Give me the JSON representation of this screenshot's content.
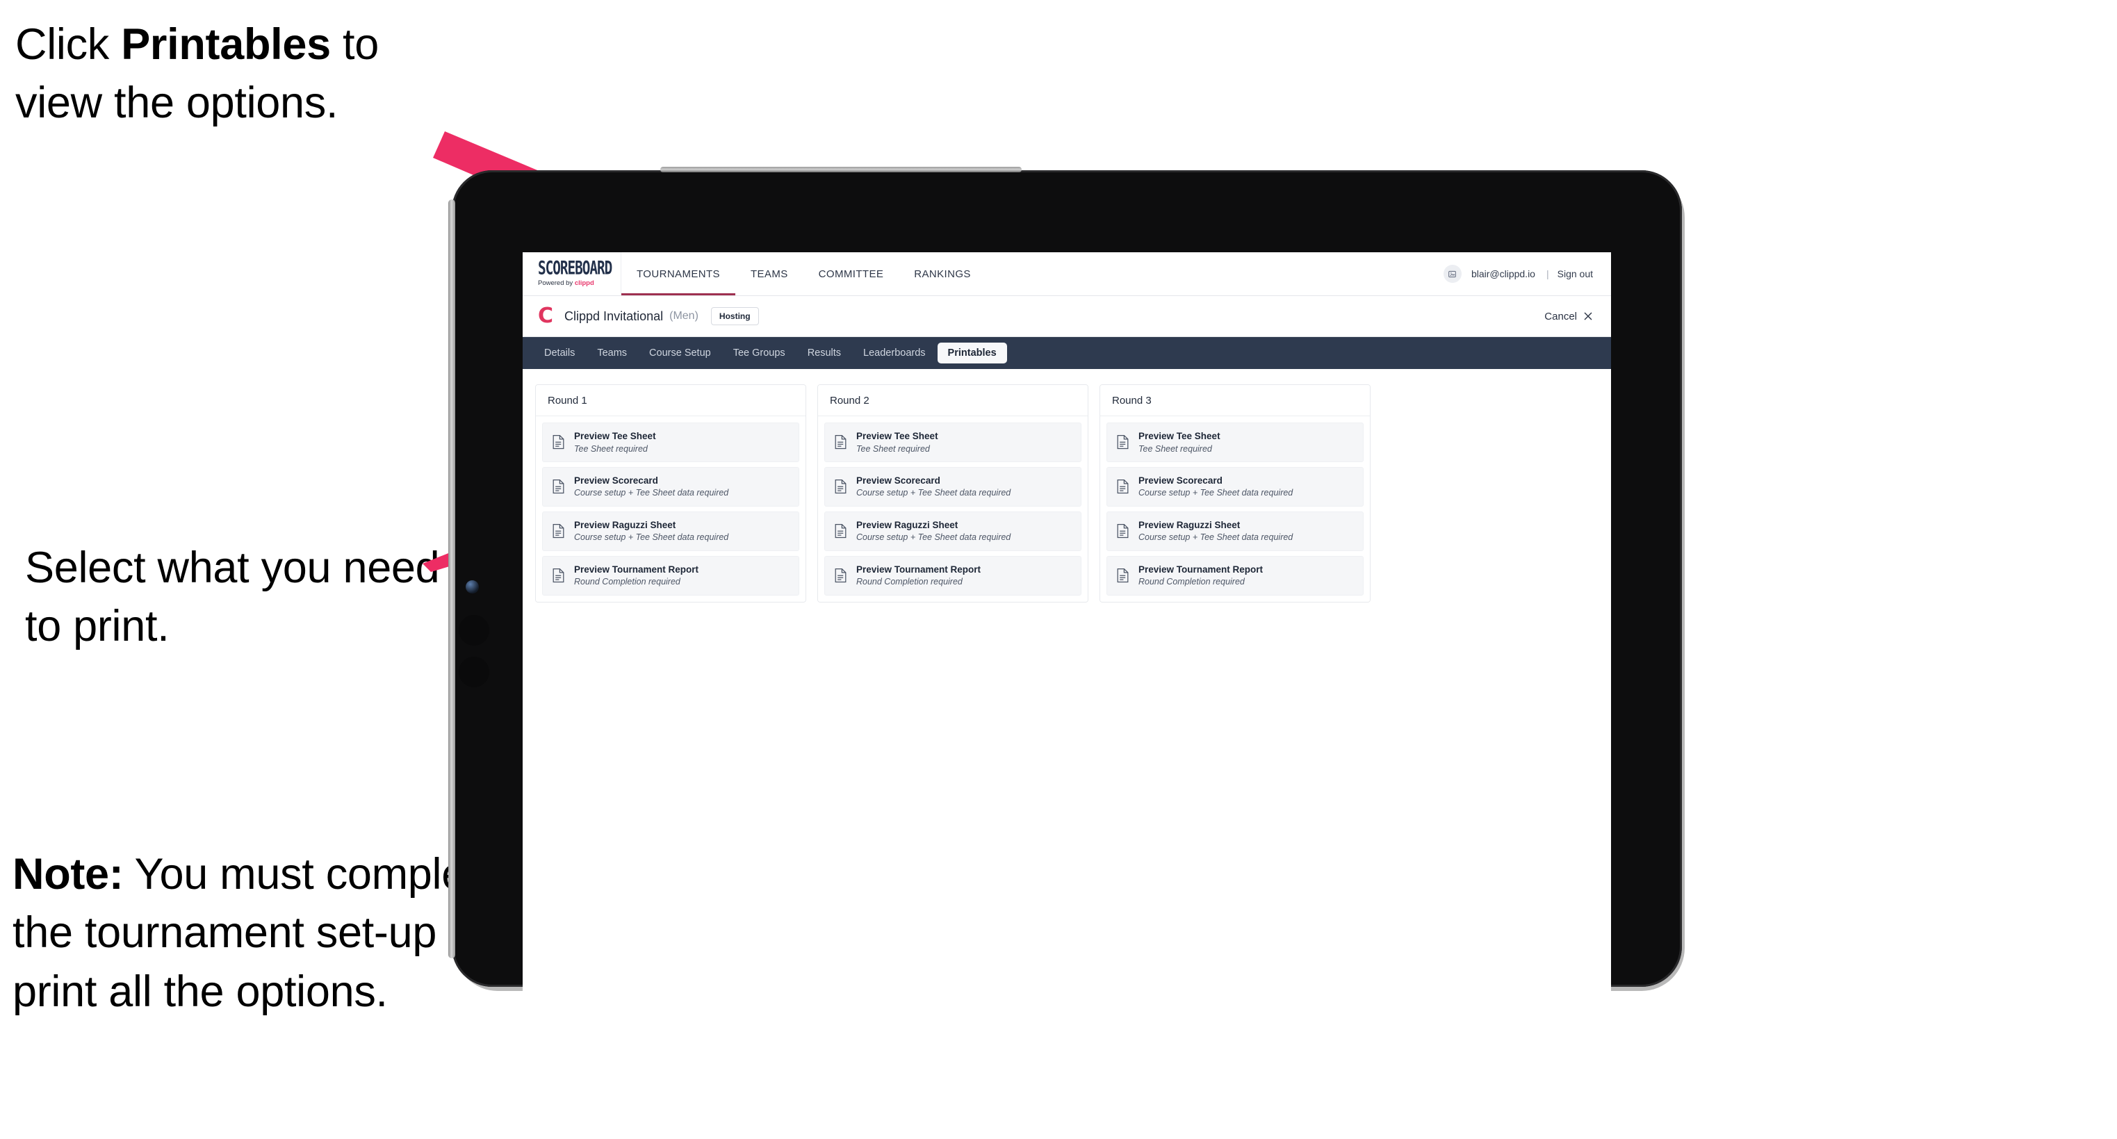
{
  "annotations": {
    "callout_1_prefix": "Click ",
    "callout_1_bold": "Printables",
    "callout_1_suffix": " to view the options.",
    "callout_2": "Select what you need to print.",
    "callout_3_bold": "Note:",
    "callout_3_rest": " You must complete the tournament set-up to print all the options."
  },
  "colors": {
    "arrow_pink": "#ed2d64",
    "brand_pink": "#e8376c",
    "tab_strip": "#2e3a4f",
    "nav_underline": "#9e3050"
  },
  "topnav": {
    "brand_main": "SCOREBOARD",
    "brand_sub_prefix": "Powered by ",
    "brand_sub_pink": "clippd",
    "links": [
      {
        "label": "TOURNAMENTS",
        "active": true
      },
      {
        "label": "TEAMS",
        "active": false
      },
      {
        "label": "COMMITTEE",
        "active": false
      },
      {
        "label": "RANKINGS",
        "active": false
      }
    ],
    "avatar_icon": "user-avatar-icon",
    "email": "blair@clippd.io",
    "separator": "|",
    "sign_out": "Sign out"
  },
  "titlebar": {
    "logo_letter": "C",
    "tournament_name": "Clippd Invitational",
    "gender": "(Men)",
    "hosting_badge": "Hosting",
    "cancel_label": "Cancel",
    "cancel_icon": "close-icon"
  },
  "tabs": [
    {
      "label": "Details",
      "active": false
    },
    {
      "label": "Teams",
      "active": false
    },
    {
      "label": "Course Setup",
      "active": false
    },
    {
      "label": "Tee Groups",
      "active": false
    },
    {
      "label": "Results",
      "active": false
    },
    {
      "label": "Leaderboards",
      "active": false
    },
    {
      "label": "Printables",
      "active": true
    }
  ],
  "rounds": [
    {
      "header": "Round 1",
      "items": [
        {
          "icon": "document-icon",
          "title": "Preview Tee Sheet",
          "desc": "Tee Sheet required"
        },
        {
          "icon": "document-icon",
          "title": "Preview Scorecard",
          "desc": "Course setup + Tee Sheet data required"
        },
        {
          "icon": "document-icon",
          "title": "Preview Raguzzi Sheet",
          "desc": "Course setup + Tee Sheet data required"
        },
        {
          "icon": "document-icon",
          "title": "Preview Tournament Report",
          "desc": "Round Completion required"
        }
      ]
    },
    {
      "header": "Round 2",
      "items": [
        {
          "icon": "document-icon",
          "title": "Preview Tee Sheet",
          "desc": "Tee Sheet required"
        },
        {
          "icon": "document-icon",
          "title": "Preview Scorecard",
          "desc": "Course setup + Tee Sheet data required"
        },
        {
          "icon": "document-icon",
          "title": "Preview Raguzzi Sheet",
          "desc": "Course setup + Tee Sheet data required"
        },
        {
          "icon": "document-icon",
          "title": "Preview Tournament Report",
          "desc": "Round Completion required"
        }
      ]
    },
    {
      "header": "Round 3",
      "items": [
        {
          "icon": "document-icon",
          "title": "Preview Tee Sheet",
          "desc": "Tee Sheet required"
        },
        {
          "icon": "document-icon",
          "title": "Preview Scorecard",
          "desc": "Course setup + Tee Sheet data required"
        },
        {
          "icon": "document-icon",
          "title": "Preview Raguzzi Sheet",
          "desc": "Course setup + Tee Sheet data required"
        },
        {
          "icon": "document-icon",
          "title": "Preview Tournament Report",
          "desc": "Round Completion required"
        }
      ]
    }
  ]
}
